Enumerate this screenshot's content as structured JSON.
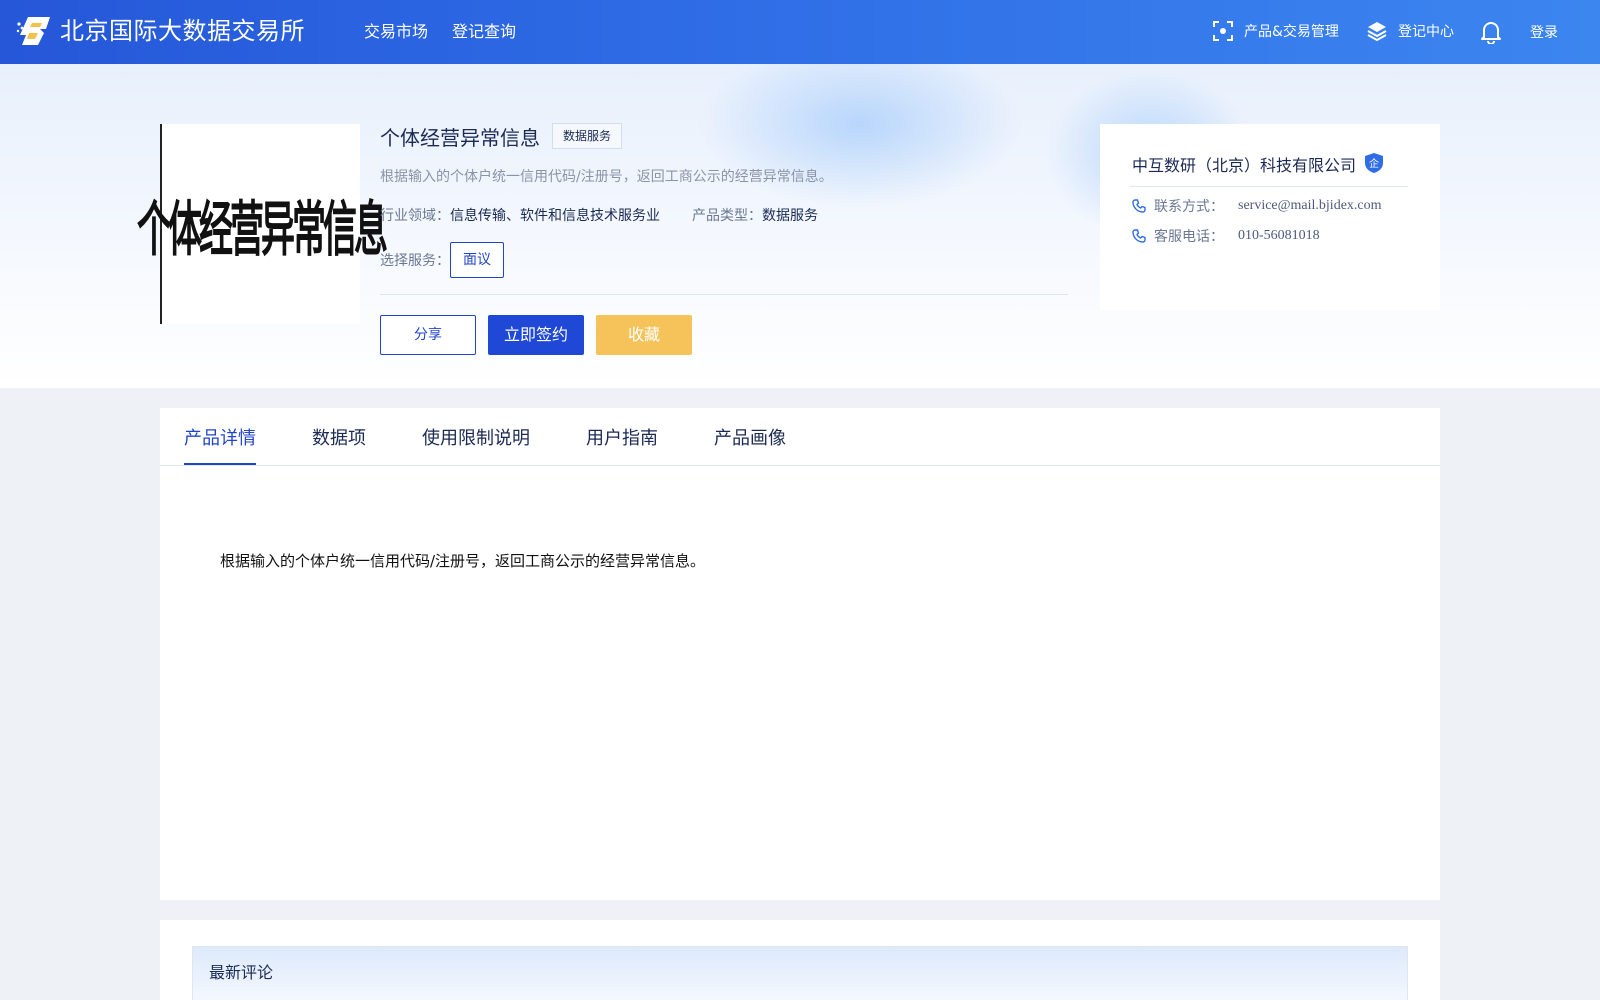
{
  "header": {
    "brand": "北京国际大数据交易所",
    "nav": [
      {
        "label": "交易市场"
      },
      {
        "label": "登记查询"
      }
    ],
    "right": {
      "product_trade": "产品&交易管理",
      "register_center": "登记中心",
      "login": "登录"
    }
  },
  "product": {
    "title": "个体经营异常信息",
    "tag": "数据服务",
    "thumbnail_text": "个体经营异常信息",
    "description": "根据输入的个体户统一信用代码/注册号，返回工商公示的经营异常信息。",
    "industry_label": "行业领域：",
    "industry_value": "信息传输、软件和信息技术服务业",
    "type_label": "产品类型：",
    "type_value": "数据服务",
    "select_label": "选择服务：",
    "select_option": "面议",
    "buttons": {
      "share": "分享",
      "sign": "立即签约",
      "favorite": "收藏"
    }
  },
  "company": {
    "name": "中互数研（北京）科技有限公司",
    "badge": "企",
    "contact_label": "联系方式：",
    "contact_value": "service@mail.bjidex.com",
    "phone_label": "客服电话：",
    "phone_value": "010-56081018"
  },
  "tabs": [
    {
      "label": "产品详情",
      "active": true
    },
    {
      "label": "数据项",
      "active": false
    },
    {
      "label": "使用限制说明",
      "active": false
    },
    {
      "label": "用户指南",
      "active": false
    },
    {
      "label": "产品画像",
      "active": false
    }
  ],
  "detail_text": "根据输入的个体户统一信用代码/注册号，返回工商公示的经营异常信息。",
  "comments": {
    "title": "最新评论"
  },
  "colors": {
    "primary": "#2245c8",
    "favorite": "#f5c35a",
    "header_start": "#2557d8",
    "header_end": "#3c86f0"
  }
}
